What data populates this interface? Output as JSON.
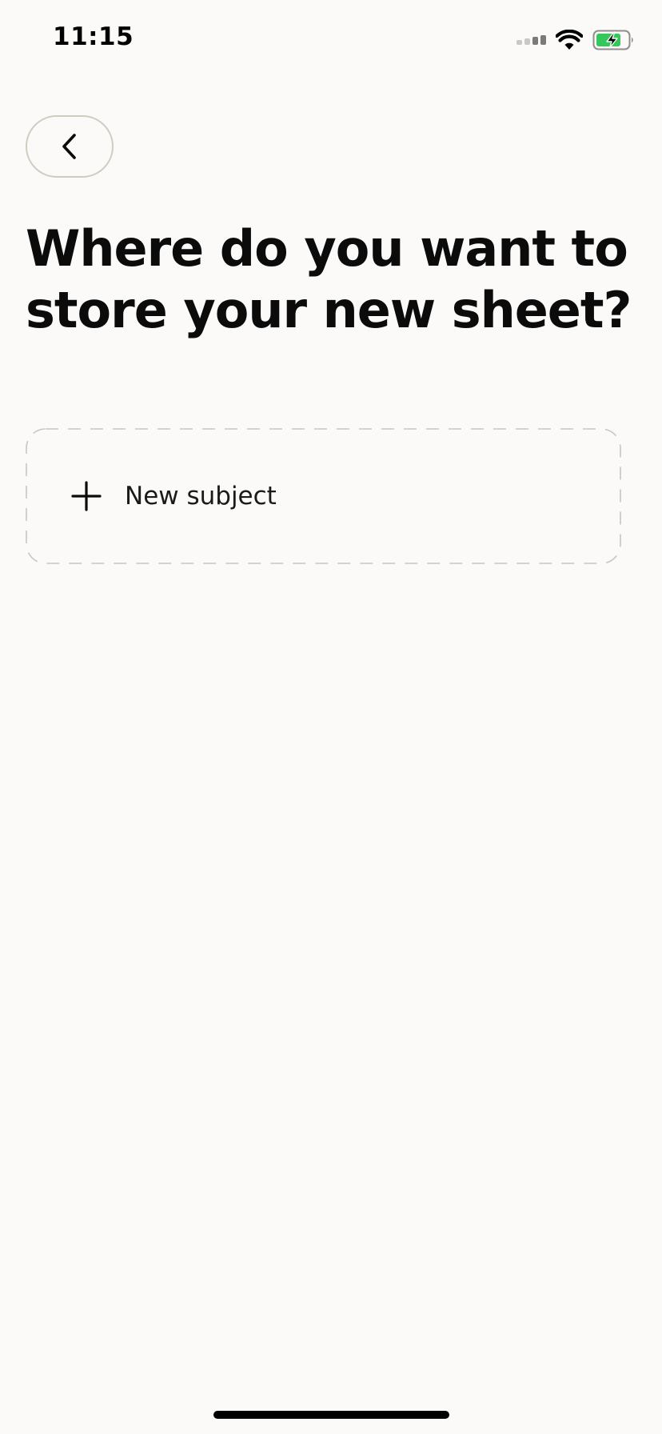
{
  "status_bar": {
    "time": "11:15",
    "icons": [
      "cellular-signal-icon",
      "wifi-icon",
      "battery-charging-icon"
    ],
    "battery_color": "#34C759"
  },
  "header": {
    "back_icon": "chevron-left-icon"
  },
  "main": {
    "title": "Where do you want to store your new sheet?",
    "new_subject": {
      "label": "New subject",
      "icon": "plus-icon"
    }
  },
  "colors": {
    "background": "#FBFAF8",
    "text": "#0B0B0B",
    "outline": "#CFCCC1"
  }
}
